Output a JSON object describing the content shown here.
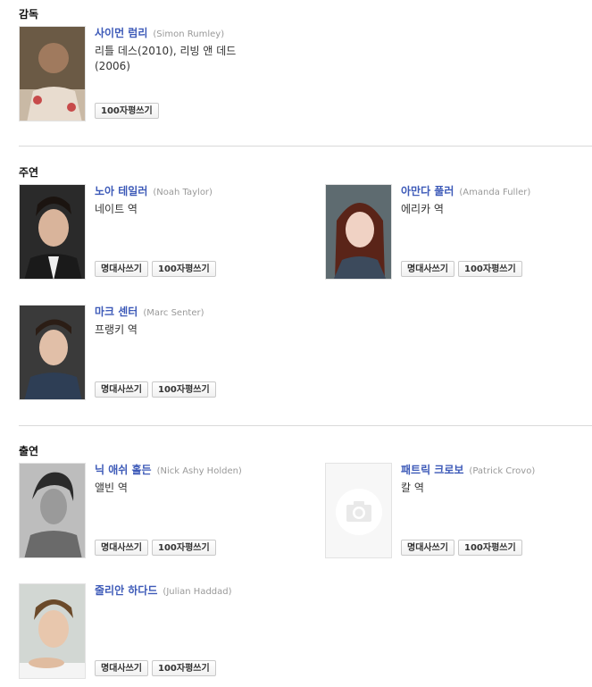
{
  "sections": {
    "director": {
      "title": "감독"
    },
    "lead": {
      "title": "주연"
    },
    "support": {
      "title": "출연"
    }
  },
  "buttons": {
    "quote": "명대사쓰기",
    "review": "100자평쓰기"
  },
  "people": {
    "simon": {
      "name": "사이먼 럼리",
      "eng": "(Simon Rumley)",
      "role": "리틀 데스(2010), 리빙 앤 데드 (2006)"
    },
    "noah": {
      "name": "노아 테일러",
      "eng": "(Noah Taylor)",
      "role": "네이트 역"
    },
    "amanda": {
      "name": "아만다 풀러",
      "eng": "(Amanda Fuller)",
      "role": "에리카 역"
    },
    "marc": {
      "name": "마크 센터",
      "eng": "(Marc Senter)",
      "role": "프랭키 역"
    },
    "nick": {
      "name": "닉 애쉬 홀든",
      "eng": "(Nick Ashy Holden)",
      "role": "앨빈 역"
    },
    "patrick": {
      "name": "패트릭 크로보",
      "eng": "(Patrick Crovo)",
      "role": "칼 역"
    },
    "julian": {
      "name": "줄리안 하다드",
      "eng": "(Julian Haddad)",
      "role": ""
    }
  }
}
